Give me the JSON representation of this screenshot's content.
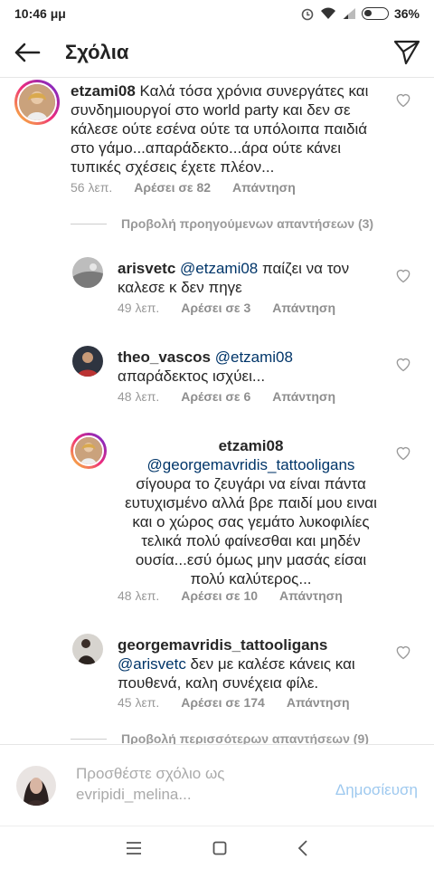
{
  "status_bar": {
    "time": "10:46 μμ",
    "battery": "36%",
    "battery_level": 0.36
  },
  "header": {
    "title": "Σχόλια",
    "back_icon": "arrow-left-icon",
    "send_icon": "paper-plane-icon"
  },
  "main_comment": {
    "username": "etzami08",
    "text": " Καλά τόσα χρόνια συνεργάτες και συνδημιουργοί στο world party και δεν σε κάλεσε ούτε εσένα ούτε τα υπόλοιπα παιδιά στο γάμο...απαράδεκτο...άρα ούτε κάνει τυπικές σχέσεις έχετε πλέον...",
    "time": "56 λεπ.",
    "likes": "Αρέσει σε 82",
    "reply": "Απάντηση"
  },
  "view_previous": "Προβολή προηγούμενων απαντήσεων (3)",
  "replies": [
    {
      "username": "arisvetc",
      "mention": "@etzami08",
      "text": " παίζει να τον καλεσε κ δεν πηγε",
      "time": "49 λεπ.",
      "likes": "Αρέσει σε 3",
      "reply": "Απάντηση"
    },
    {
      "username": "theo_vascos",
      "mention": "@etzami08",
      "text": " απαράδεκτος ισχύει...",
      "time": "48 λεπ.",
      "likes": "Αρέσει σε 6",
      "reply": "Απάντηση"
    },
    {
      "username": "etzami08",
      "mention": "@georgemavridis_tattooligans",
      "text": " σίγουρα το ζευγάρι να είναι πάντα ευτυχισμένο αλλά βρε παιδί μου ειναι και ο χώρος σας γεμάτο λυκοφιλίες τελικά πολύ φαίνεσθαι και μηδέν ουσία...εσύ όμως μην μασάς είσαι πολύ καλύτερος...",
      "time": "48 λεπ.",
      "likes": "Αρέσει σε 10",
      "reply": "Απάντηση"
    },
    {
      "username": "georgemavridis_tattooligans",
      "mention": "@arisvetc",
      "text": " δεν με καλέσε κάνεις και πουθενά, καλη συνέχεια φίλε.",
      "time": "45 λεπ.",
      "likes": "Αρέσει σε 174",
      "reply": "Απάντηση"
    }
  ],
  "view_more": "Προβολή περισσότερων απαντήσεων (9)",
  "compose": {
    "placeholder": "Προσθέστε σχόλιο ως evripidi_melina...",
    "publish": "Δημοσίευση"
  },
  "navbar": {
    "menu_icon": "menu-icon",
    "home_icon": "square-home-icon",
    "back_icon": "triangle-back-icon"
  },
  "colors": {
    "mention": "#003569",
    "publish": "#9ec9ef",
    "meta": "#999999"
  }
}
